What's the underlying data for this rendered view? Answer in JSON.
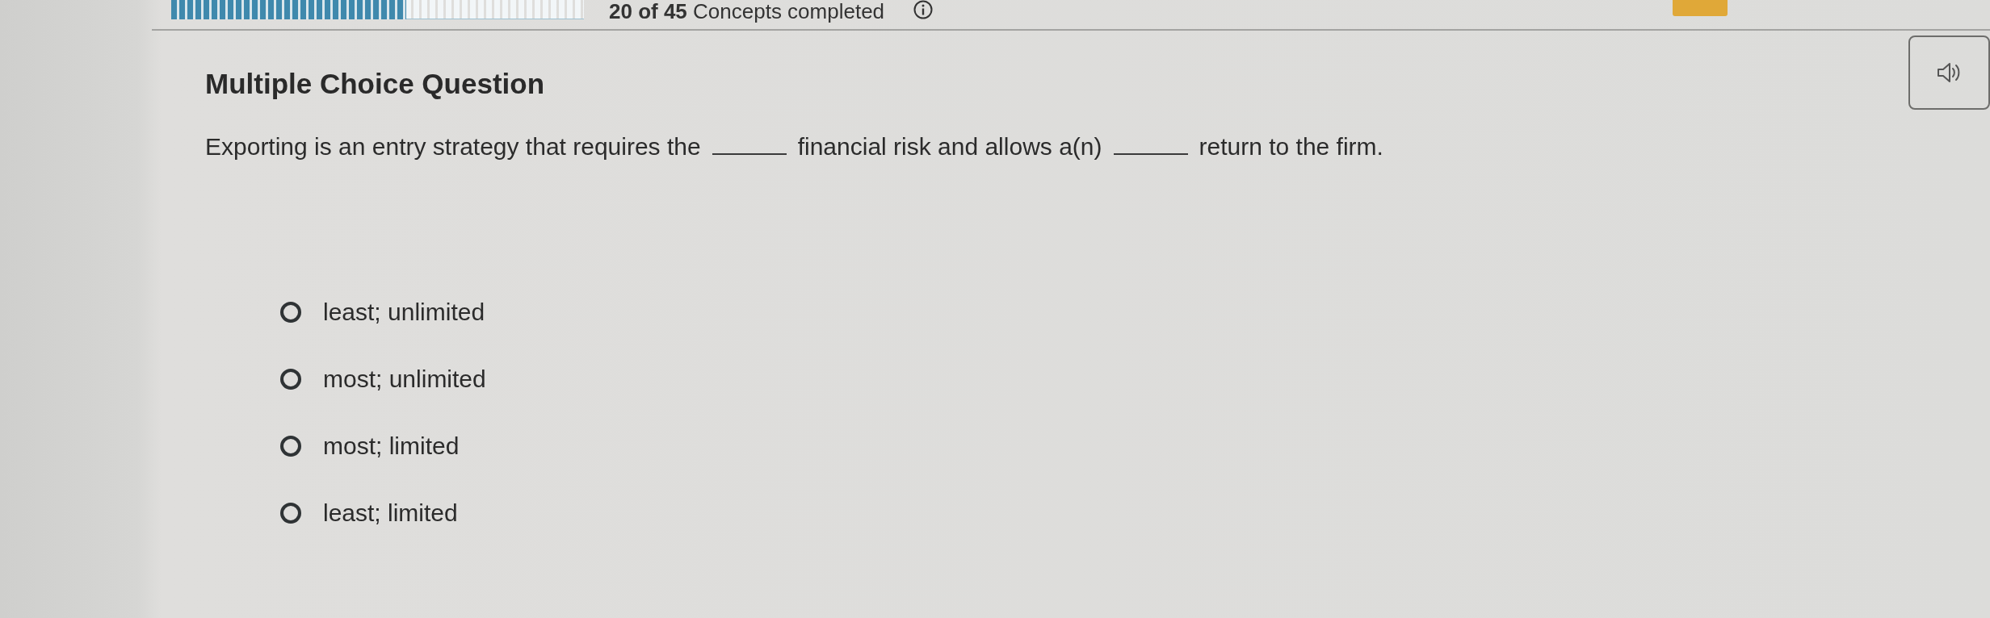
{
  "progress": {
    "level": 0.57,
    "caption": "**20 of 45** Concepts completed"
  },
  "question": {
    "heading": "Multiple Choice Question",
    "parts": [
      {
        "kind": "text",
        "text": "Exporting is an entry strategy that requires the"
      },
      {
        "kind": "blank"
      },
      {
        "kind": "text",
        "text": "financial risk and allows a(n)"
      },
      {
        "kind": "blank"
      },
      {
        "kind": "text",
        "text": "return to the firm."
      }
    ]
  },
  "options": [
    {
      "label": "least; unlimited",
      "selected": false
    },
    {
      "label": "most; unlimited",
      "selected": false
    },
    {
      "label": "most; limited",
      "selected": false
    },
    {
      "label": "least; limited",
      "selected": false
    }
  ]
}
